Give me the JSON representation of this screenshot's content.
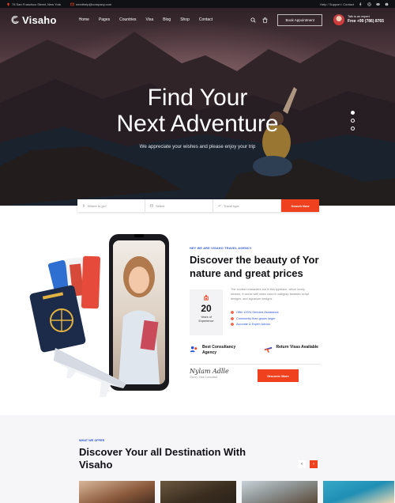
{
  "topbar": {
    "address": "75 San Francisco Street, New York",
    "email": "needhelp@company.com",
    "links": "Help / Support / Contact"
  },
  "nav": {
    "logo": "Visaho",
    "menu": [
      "Home",
      "Pages",
      "Countries",
      "Visa",
      "Blog",
      "Shop",
      "Contact"
    ],
    "book_button": "Book Appointment",
    "talk_label": "Talk to an expert",
    "phone": "Free +99 (786) 8765"
  },
  "hero": {
    "title_line1": "Find Your",
    "title_line2": "Next Adventure",
    "subtitle": "We appreciate your wishes and please enjoy your trip",
    "slide_count": 3,
    "active_slide": 1
  },
  "search": {
    "where_placeholder": "Where to go?",
    "date_placeholder": "Select",
    "type_placeholder": "Travel type",
    "button": "Search Now"
  },
  "about": {
    "eyebrow": "HEY WE ARE VISAHO TRAVEL AGENCY",
    "title": "Discover the beauty of Yor nature and great prices",
    "stat_number": "20",
    "stat_label": "Years of Experience",
    "description": "The coolest characters are in this typeface, which lovely strokes. It works well when used in calligrap fantastic script designs, and signature designs",
    "checks": [
      "Offer 100% Genuine Assistance",
      "Community than grows larger",
      "Accurate & Expert Advice"
    ],
    "feature1": "Best Consultancy Agency",
    "feature2": "Return Visas Available",
    "signature": "Nylam Adlle",
    "signature_caption": "Owner, Visa Consultant",
    "discover_button": "Discover More"
  },
  "destinations": {
    "eyebrow": "WHAT WE OFFER",
    "title": "Discover Your all Destination With Visaho",
    "prev": "‹",
    "next": "›"
  },
  "colors": {
    "accent": "#f0411f",
    "link_blue": "#2a54d8",
    "dark": "#0f1115"
  }
}
